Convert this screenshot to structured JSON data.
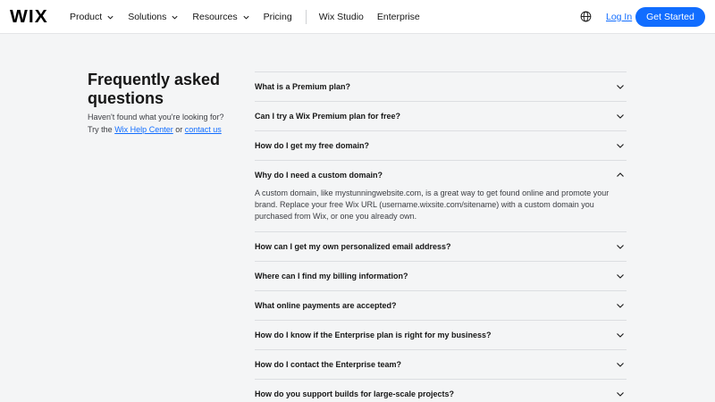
{
  "header": {
    "logo": "WIX",
    "nav": [
      {
        "label": "Product",
        "dropdown": true
      },
      {
        "label": "Solutions",
        "dropdown": true
      },
      {
        "label": "Resources",
        "dropdown": true
      },
      {
        "label": "Pricing",
        "dropdown": false
      }
    ],
    "nav_secondary": [
      {
        "label": "Wix Studio"
      },
      {
        "label": "Enterprise"
      }
    ],
    "globe_icon": "globe-icon",
    "login_label": "Log In",
    "cta_label": "Get Started"
  },
  "faq": {
    "title": "Frequently asked questions",
    "subtitle_prefix": "Haven't found what you're looking for? Try the ",
    "help_center_link": "Wix Help Center",
    "subtitle_or": " or ",
    "contact_link": "contact us",
    "items": [
      {
        "question": "What is a Premium plan?",
        "expanded": false,
        "answer": ""
      },
      {
        "question": "Can I try a Wix Premium plan for free?",
        "expanded": false,
        "answer": ""
      },
      {
        "question": "How do I get my free domain?",
        "expanded": false,
        "answer": ""
      },
      {
        "question": "Why do I need a custom domain?",
        "expanded": true,
        "answer": "A custom domain, like mystunningwebsite.com, is a great way to get found online and promote your brand. Replace your free Wix URL (username.wixsite.com/sitename) with a custom domain you purchased from Wix, or one you already own."
      },
      {
        "question": "How can I get my own personalized email address?",
        "expanded": false,
        "answer": ""
      },
      {
        "question": "Where can I find my billing information?",
        "expanded": false,
        "answer": ""
      },
      {
        "question": "What online payments are accepted?",
        "expanded": false,
        "answer": ""
      },
      {
        "question": "How do I know if the Enterprise plan is right for my business?",
        "expanded": false,
        "answer": ""
      },
      {
        "question": "How do I contact the Enterprise team?",
        "expanded": false,
        "answer": ""
      },
      {
        "question": "How do you support builds for large-scale projects?",
        "expanded": false,
        "answer": ""
      }
    ]
  },
  "colors": {
    "accent": "#116dff",
    "background": "#f4f5f6",
    "header_bg": "#ffffff",
    "text": "#161616",
    "divider": "#dcdee1"
  }
}
